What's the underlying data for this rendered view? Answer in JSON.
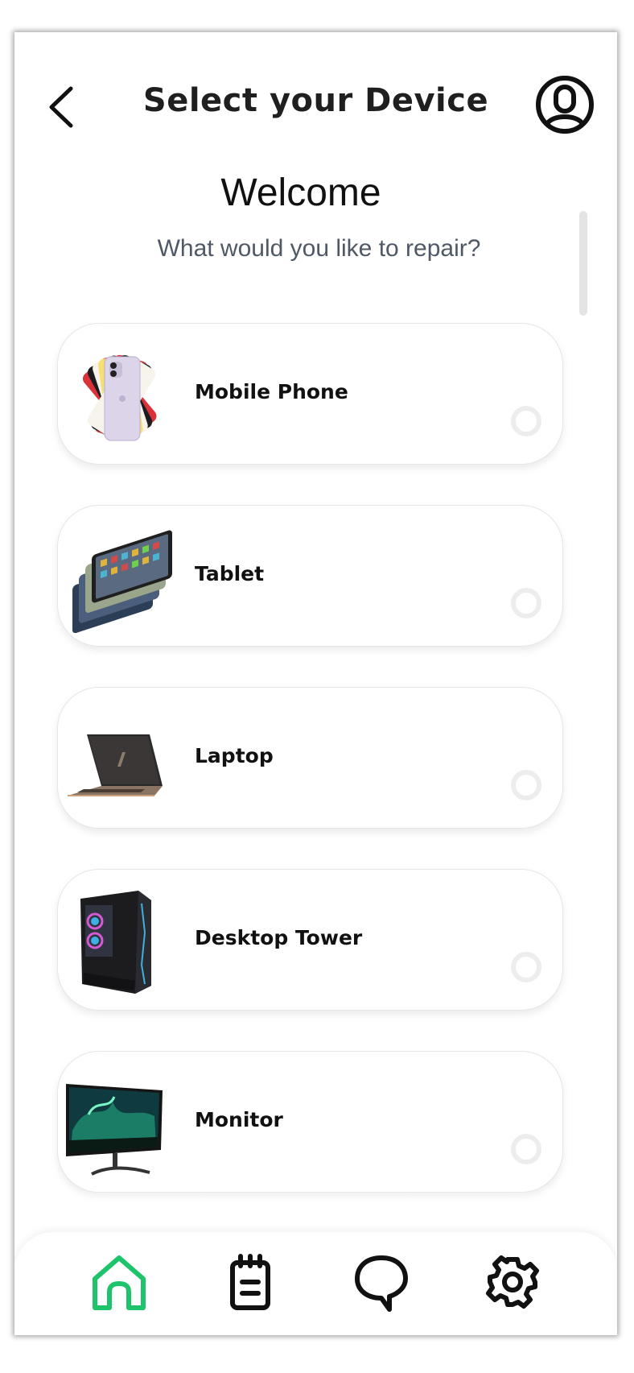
{
  "header": {
    "title": "Select your Device",
    "back_icon": "chevron-left-icon",
    "profile_icon": "user-circle-icon"
  },
  "intro": {
    "welcome": "Welcome",
    "subtitle": "What would you like to repair?"
  },
  "devices": [
    {
      "label": "Mobile Phone",
      "image": "mobile-phone-image",
      "selected": false
    },
    {
      "label": "Tablet",
      "image": "tablet-image",
      "selected": false
    },
    {
      "label": "Laptop",
      "image": "laptop-image",
      "selected": false
    },
    {
      "label": "Desktop Tower",
      "image": "desktop-tower-image",
      "selected": false
    },
    {
      "label": "Monitor",
      "image": "monitor-image",
      "selected": false
    }
  ],
  "bottom_nav": {
    "items": [
      {
        "icon": "home-icon",
        "active": true
      },
      {
        "icon": "clipboard-icon",
        "active": false
      },
      {
        "icon": "chat-icon",
        "active": false
      },
      {
        "icon": "gear-icon",
        "active": false
      }
    ],
    "active_color": "#1ec46b",
    "inactive_color": "#111111"
  }
}
